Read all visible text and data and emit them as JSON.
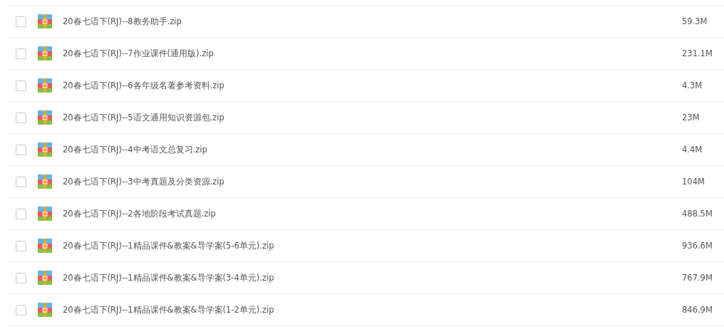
{
  "files": [
    {
      "name": "20春七语下(RJ)--8教务助手.zip",
      "size": "59.3M",
      "checked": false
    },
    {
      "name": "20春七语下(RJ)--7作业课件(通用版).zip",
      "size": "231.1M",
      "checked": false
    },
    {
      "name": "20春七语下(RJ)--6各年级名著参考资料.zip",
      "size": "4.3M",
      "checked": false
    },
    {
      "name": "20春七语下(RJ)--5语文通用知识资源包.zip",
      "size": "23M",
      "checked": false
    },
    {
      "name": "20春七语下(RJ)--4中考语文总复习.zip",
      "size": "4.4M",
      "checked": false
    },
    {
      "name": "20春七语下(RJ)--3中考真题及分类资源.zip",
      "size": "104M",
      "checked": false
    },
    {
      "name": "20春七语下(RJ)--2各地阶段考试真题.zip",
      "size": "488.5M",
      "checked": false
    },
    {
      "name": "20春七语下(RJ)--1精品课件&教案&导学案(5-6单元).zip",
      "size": "936.6M",
      "checked": false
    },
    {
      "name": "20春七语下(RJ)--1精品课件&教案&导学案(3-4单元).zip",
      "size": "767.9M",
      "checked": false
    },
    {
      "name": "20春七语下(RJ)--1精品课件&教案&导学案(1-2单元).zip",
      "size": "846.9M",
      "checked": false
    }
  ]
}
